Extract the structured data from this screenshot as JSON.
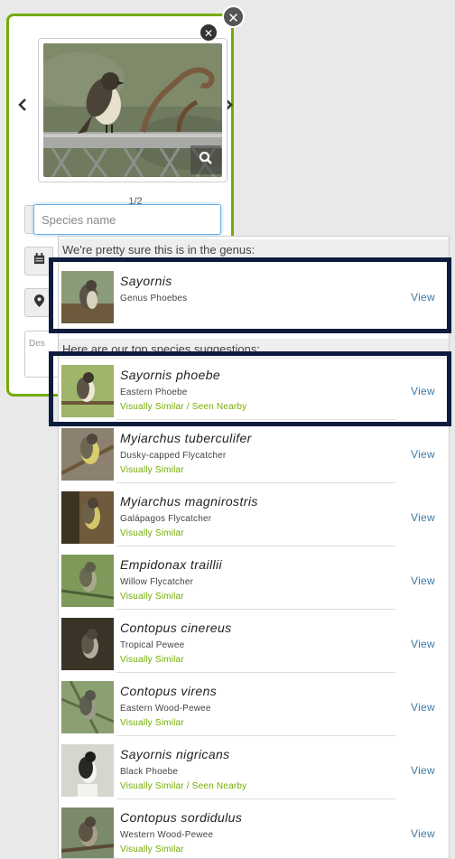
{
  "card": {
    "counter": "1/2",
    "species_placeholder": "Species name",
    "description_placeholder": "Des"
  },
  "icons": {
    "close": "x-icon",
    "prev": "chevron-left-icon",
    "next": "chevron-right-icon",
    "zoom": "magnifier-icon",
    "search": "search-icon",
    "date": "calendar-icon",
    "location": "map-marker-icon"
  },
  "suggestions": {
    "genus_header": "We're pretty sure this is in the genus:",
    "species_header": "Here are our top species suggestions:",
    "view_label": "View",
    "genus": {
      "scientific": "Sayornis",
      "common": "Genus Phoebes",
      "reason": ""
    },
    "species": [
      {
        "scientific": "Sayornis phoebe",
        "common": "Eastern Phoebe",
        "reason": "Visually Similar / Seen Nearby"
      },
      {
        "scientific": "Myiarchus tuberculifer",
        "common": "Dusky-capped Flycatcher",
        "reason": "Visually Similar"
      },
      {
        "scientific": "Myiarchus magnirostris",
        "common": "Galápagos Flycatcher",
        "reason": "Visually Similar"
      },
      {
        "scientific": "Empidonax traillii",
        "common": "Willow Flycatcher",
        "reason": "Visually Similar"
      },
      {
        "scientific": "Contopus cinereus",
        "common": "Tropical Pewee",
        "reason": "Visually Similar"
      },
      {
        "scientific": "Contopus virens",
        "common": "Eastern Wood-Pewee",
        "reason": "Visually Similar"
      },
      {
        "scientific": "Sayornis nigricans",
        "common": "Black Phoebe",
        "reason": "Visually Similar / Seen Nearby"
      },
      {
        "scientific": "Contopus sordidulus",
        "common": "Western Wood-Pewee",
        "reason": "Visually Similar"
      }
    ]
  },
  "colors": {
    "accent_green": "#74ac00",
    "link_blue": "#3b79a6",
    "highlight_navy": "#0d1c3e"
  }
}
